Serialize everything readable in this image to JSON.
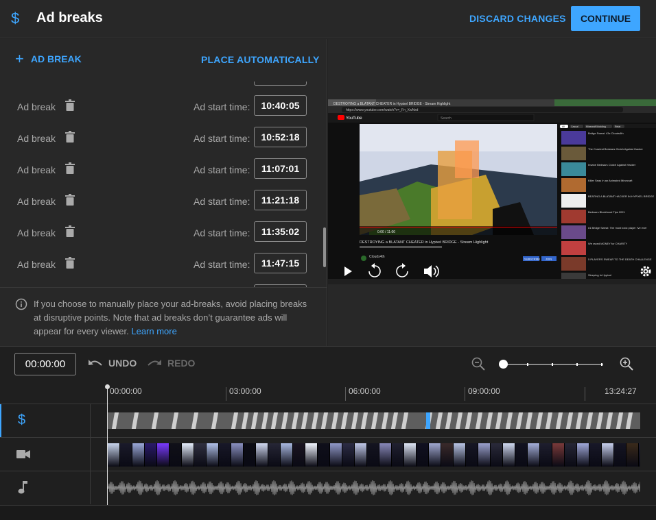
{
  "header": {
    "title": "Ad breaks",
    "discard_label": "DISCARD CHANGES",
    "continue_label": "CONTINUE",
    "accent_color": "#3ea6ff"
  },
  "left_panel": {
    "add_label": "AD BREAK",
    "place_label": "PLACE AUTOMATICALLY",
    "breaks": [
      {
        "label": "Ad break",
        "start_label": "Ad start time:",
        "time": "10:40:05"
      },
      {
        "label": "Ad break",
        "start_label": "Ad start time:",
        "time": "10:52:18"
      },
      {
        "label": "Ad break",
        "start_label": "Ad start time:",
        "time": "11:07:01"
      },
      {
        "label": "Ad break",
        "start_label": "Ad start time:",
        "time": "11:21:18"
      },
      {
        "label": "Ad break",
        "start_label": "Ad start time:",
        "time": "11:35:02"
      },
      {
        "label": "Ad break",
        "start_label": "Ad start time:",
        "time": "11:47:15"
      }
    ],
    "info_text": "If you choose to manually place your ad-breaks, avoid placing breaks at disruptive points. Note that ad breaks don’t guarantee ads will appear for every viewer.",
    "learn_more": "Learn more"
  },
  "toolbar": {
    "timecode": "00:00:00",
    "undo_label": "UNDO",
    "redo_label": "REDO"
  },
  "timeline": {
    "ruler_labels": [
      "00:00:00",
      "03:00:00",
      "06:00:00",
      "09:00:00",
      "13:24:27"
    ]
  },
  "video": {
    "page_title": "DESTROYING a BLATANT CHEATER in Hypixel BRIDGE - Stream Highlight",
    "browser_url": "https://www.youtube.com/watch?v=_Fn_XwNxd",
    "site_label": "YouTube",
    "search_placeholder": "Search",
    "chips": [
      "All",
      "Casual",
      "Minecraft Modding",
      "Relat"
    ],
    "player_time": "0:00 / 11:00",
    "rec_titles": [
      "Bridge Sweat: 43x Clouds4th",
      "The Craziest Bedwars Clutch Against Hacker",
      "Insane Bedwars Clutch Against Hacker",
      "Killer Seas In an Animated Minecraft",
      "BEATING A BLATANT HACKER IN HYPIXEL BRIDGE",
      "Bedwars Blockhood Tips 2021",
      "#1 Bridge Sweat: The most toxic player I've ever",
      "We raced MONEY for CHARITY",
      "5 PLAYERS SWEAR TO THE DEATH CHALLENGE",
      "Sleeping In Hypixel"
    ],
    "desc_channel": "Clouds4th",
    "cta_subscribe": "SUBSCRIBE",
    "cta_join": "JOIN"
  }
}
